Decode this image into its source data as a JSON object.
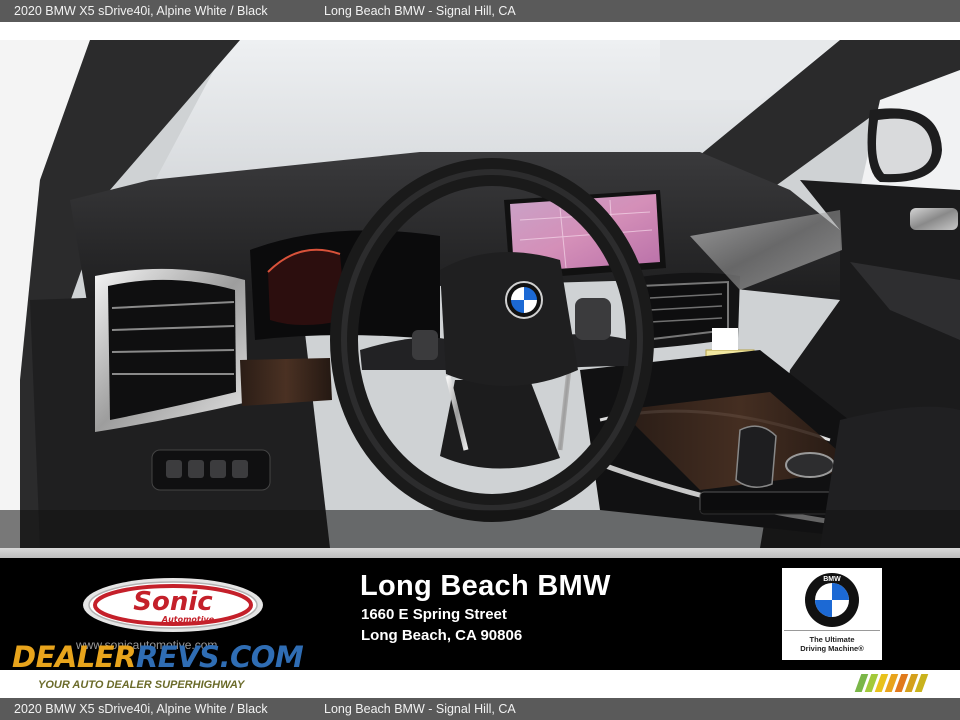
{
  "caption": {
    "model": "2020 BMW X5 sDrive40i,  Alpine White / Black",
    "dealer_location": "Long Beach BMW - Signal Hill, CA"
  },
  "photo": {
    "screen_map_labels": []
  },
  "banner": {
    "sonic_logo_text": "Sonic",
    "sonic_logo_subtext": "Automotive",
    "sonic_url": "www.sonicautomotive.com",
    "dealer_name": "Long Beach BMW",
    "dealer_street": "1660 E Spring Street",
    "dealer_city": "Long Beach, CA 90806",
    "bmw_tagline_line1": "The Ultimate",
    "bmw_tagline_line2": "Driving Machine®",
    "bmw_roundel_letters": "BMW"
  },
  "watermark": {
    "logo_part1": "DEALER",
    "logo_part2": "REVS",
    "logo_suffix": ".COM",
    "tagline": "YOUR AUTO DEALER SUPERHIGHWAY"
  },
  "colors": {
    "caption_bg": "#5a5a5a",
    "banner_bg": "#000000",
    "sonic_red": "#c4202a",
    "dealerrevs_orange": "#e8a41c",
    "dealerrevs_blue": "#2f6db4",
    "bmw_blue": "#1c69d4"
  },
  "icons": {
    "bmw_roundel": "bmw-roundel-icon",
    "steering_badge": "bmw-steering-badge-icon",
    "sonic_logo": "sonic-automotive-logo-icon",
    "wm_stripes": "wm-stripes-logo-icon"
  }
}
